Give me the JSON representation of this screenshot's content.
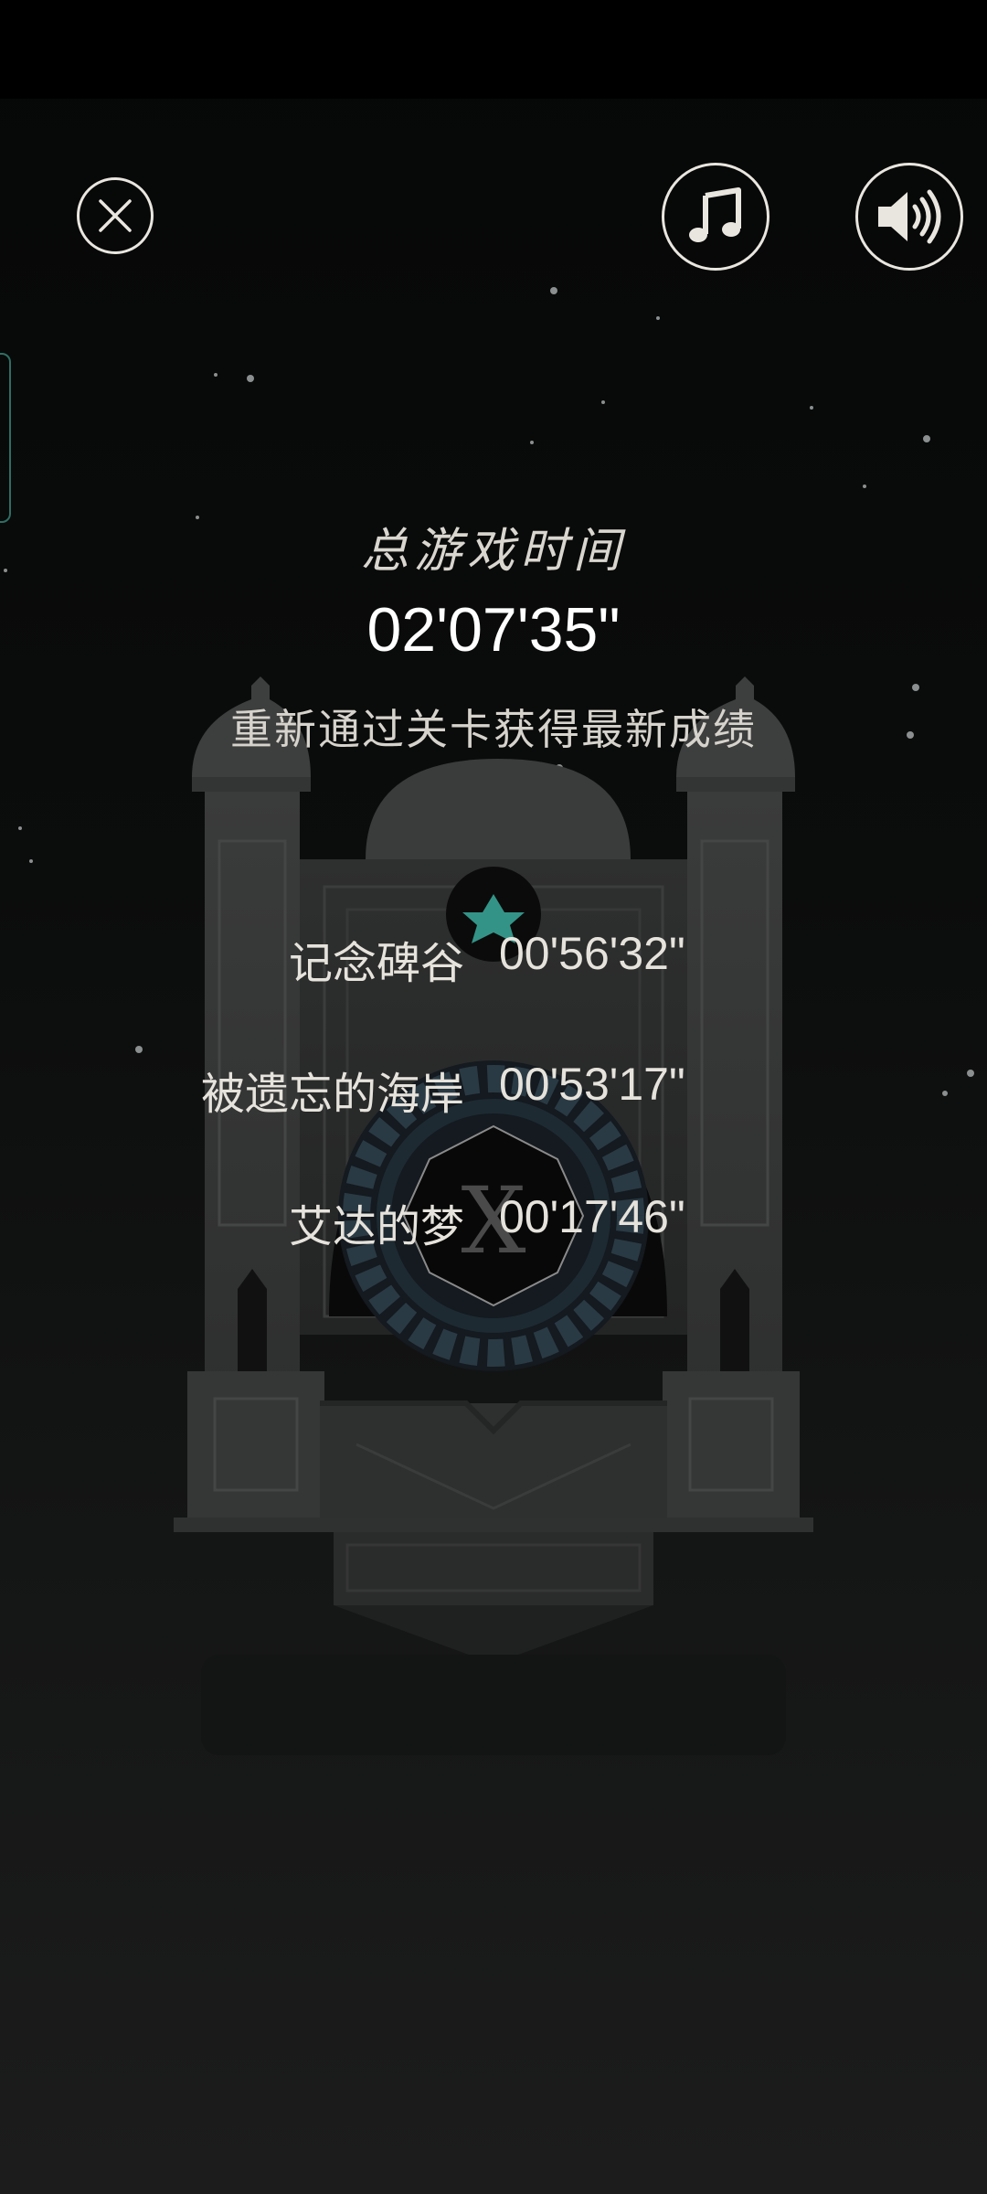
{
  "header": {
    "close_icon": "close-icon",
    "music_icon": "music-note-icon",
    "sound_icon": "speaker-volume-icon"
  },
  "summary": {
    "title": "总游戏时间",
    "total_time": "02'07'35\"",
    "hint": "重新通过关卡获得最新成绩"
  },
  "levels": [
    {
      "name": "记念碑谷",
      "time": "00'56'32\""
    },
    {
      "name": "被遗忘的海岸",
      "time": "00'53'17\""
    },
    {
      "name": "艾达的梦",
      "time": "00'17'46\""
    }
  ],
  "monument": {
    "chapter_numeral": "X"
  },
  "colors": {
    "icon_stroke": "#e9e6df",
    "accent_teal": "#2f6e63",
    "star_glow": "#3fb5a6"
  }
}
